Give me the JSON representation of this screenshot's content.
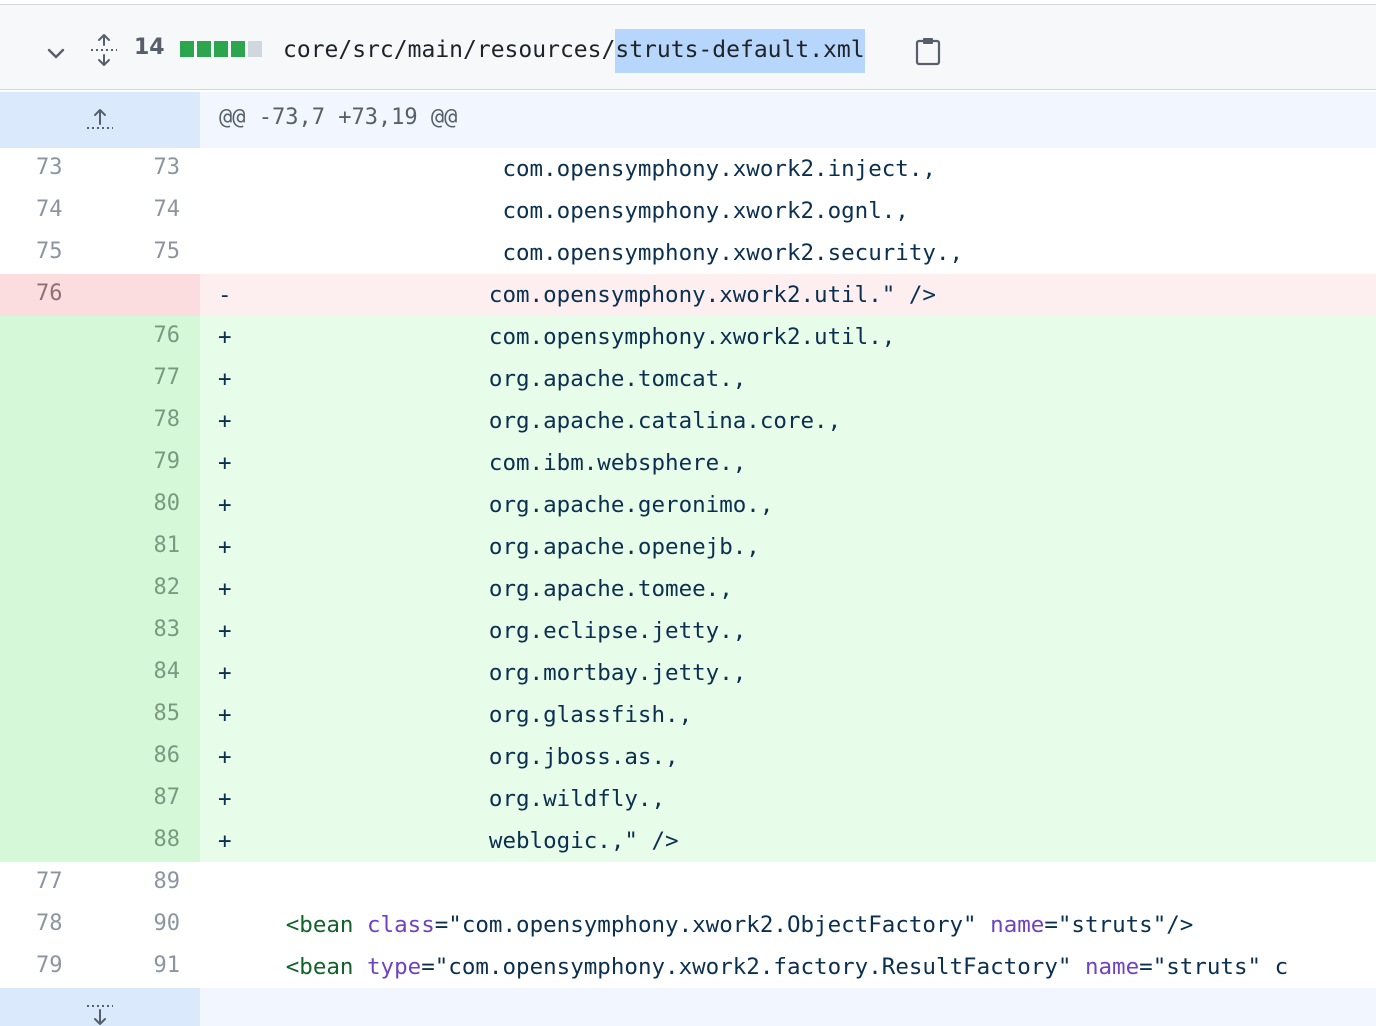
{
  "file": {
    "changed_lines": "14",
    "path_prefix": "core/src/main/resources/",
    "path_selected": "struts-default.xml",
    "diffstat": [
      "add",
      "add",
      "add",
      "add",
      "neutral"
    ]
  },
  "colors": {
    "add": "#2da44e",
    "neutral": "#d0d7de",
    "selection": "#b7d6fb"
  },
  "hunk": {
    "header": "@@ -73,7 +73,19 @@"
  },
  "lines": [
    {
      "type": "ctx",
      "old": "73",
      "new": "73",
      "sign": "",
      "text": "                    com.opensymphony.xwork2.inject.,"
    },
    {
      "type": "ctx",
      "old": "74",
      "new": "74",
      "sign": "",
      "text": "                    com.opensymphony.xwork2.ognl.,"
    },
    {
      "type": "ctx",
      "old": "75",
      "new": "75",
      "sign": "",
      "text": "                    com.opensymphony.xwork2.security.,"
    },
    {
      "type": "del",
      "old": "76",
      "new": "",
      "sign": "-",
      "text": "                   com.opensymphony.xwork2.util.\" />"
    },
    {
      "type": "add",
      "old": "",
      "new": "76",
      "sign": "+",
      "text": "                   com.opensymphony.xwork2.util.,"
    },
    {
      "type": "add",
      "old": "",
      "new": "77",
      "sign": "+",
      "text": "                   org.apache.tomcat.,"
    },
    {
      "type": "add",
      "old": "",
      "new": "78",
      "sign": "+",
      "text": "                   org.apache.catalina.core.,"
    },
    {
      "type": "add",
      "old": "",
      "new": "79",
      "sign": "+",
      "text": "                   com.ibm.websphere.,"
    },
    {
      "type": "add",
      "old": "",
      "new": "80",
      "sign": "+",
      "text": "                   org.apache.geronimo.,"
    },
    {
      "type": "add",
      "old": "",
      "new": "81",
      "sign": "+",
      "text": "                   org.apache.openejb.,"
    },
    {
      "type": "add",
      "old": "",
      "new": "82",
      "sign": "+",
      "text": "                   org.apache.tomee.,"
    },
    {
      "type": "add",
      "old": "",
      "new": "83",
      "sign": "+",
      "text": "                   org.eclipse.jetty.,"
    },
    {
      "type": "add",
      "old": "",
      "new": "84",
      "sign": "+",
      "text": "                   org.mortbay.jetty.,"
    },
    {
      "type": "add",
      "old": "",
      "new": "85",
      "sign": "+",
      "text": "                   org.glassfish.,"
    },
    {
      "type": "add",
      "old": "",
      "new": "86",
      "sign": "+",
      "text": "                   org.jboss.as.,"
    },
    {
      "type": "add",
      "old": "",
      "new": "87",
      "sign": "+",
      "text": "                   org.wildfly.,"
    },
    {
      "type": "add",
      "old": "",
      "new": "88",
      "sign": "+",
      "text": "                   weblogic.,\" />"
    },
    {
      "type": "ctx",
      "old": "77",
      "new": "89",
      "sign": "",
      "text": ""
    },
    {
      "type": "ctx",
      "old": "78",
      "new": "90",
      "sign": "",
      "text": "",
      "bean": {
        "open": "    <bean ",
        "attr1": "class",
        "val1": "=\"com.opensymphony.xwork2.ObjectFactory\" ",
        "attr2": "name",
        "val2": "=\"struts\"/>"
      }
    },
    {
      "type": "ctx",
      "old": "79",
      "new": "91",
      "sign": "",
      "text": "",
      "bean": {
        "open": "    <bean ",
        "attr1": "type",
        "val1": "=\"com.opensymphony.xwork2.factory.ResultFactory\" ",
        "attr2": "name",
        "val2": "=\"struts\" c"
      }
    }
  ]
}
